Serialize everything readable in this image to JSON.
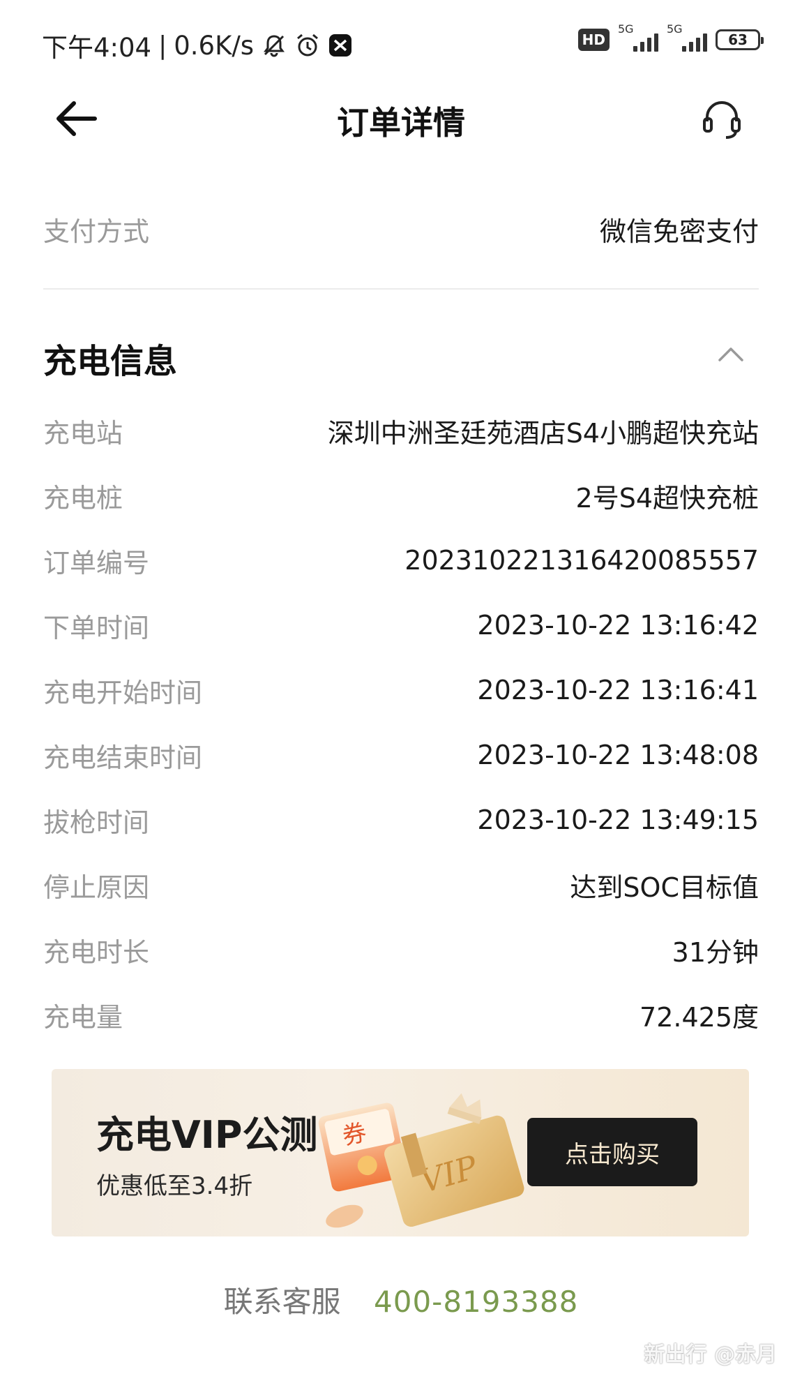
{
  "status_bar": {
    "time": "下午4:04",
    "separator": "|",
    "net_speed": "0.6K/s",
    "hd_label": "HD",
    "sim1_label": "5G",
    "sim2_label": "5G",
    "battery": "63"
  },
  "header": {
    "title": "订单详情"
  },
  "payment": {
    "label": "支付方式",
    "value": "微信免密支付"
  },
  "charging_info": {
    "title": "充电信息",
    "rows": [
      {
        "label": "充电站",
        "value": "深圳中洲圣廷苑酒店S4小鹏超快充站"
      },
      {
        "label": "充电桩",
        "value": "2号S4超快充桩"
      },
      {
        "label": "订单编号",
        "value": "202310221316420085557"
      },
      {
        "label": "下单时间",
        "value": "2023-10-22 13:16:42"
      },
      {
        "label": "充电开始时间",
        "value": "2023-10-22 13:16:41"
      },
      {
        "label": "充电结束时间",
        "value": "2023-10-22 13:48:08"
      },
      {
        "label": "拔枪时间",
        "value": "2023-10-22 13:49:15"
      },
      {
        "label": "停止原因",
        "value": "达到SOC目标值"
      },
      {
        "label": "充电时长",
        "value": "31分钟"
      },
      {
        "label": "充电量",
        "value": "72.425度"
      }
    ]
  },
  "banner": {
    "title": "充电VIP公测",
    "subtitle": "优惠低至3.4折",
    "button": "点击购买",
    "coupon_text": "券",
    "card_text": "VIP"
  },
  "contact": {
    "label": "联系客服",
    "phone": "400-8193388"
  },
  "watermark": "新出行 @赤月"
}
